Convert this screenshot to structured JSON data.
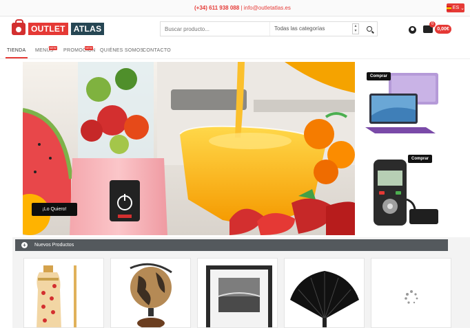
{
  "topbar": {
    "phone": "(+34) 611 938 088",
    "contact": "info@outletatlas.es",
    "language": "ES"
  },
  "brand": {
    "name_part1": "OUTLET",
    "name_part2": "ATLAS",
    "accent": "#e53935",
    "dark": "#264653"
  },
  "search": {
    "placeholder": "Buscar producto...",
    "category": "Todas las categorías"
  },
  "cart": {
    "count": "0",
    "total": "0,00€"
  },
  "nav": {
    "items": [
      {
        "label": "TIENDA"
      },
      {
        "label": "MENÚS",
        "badge": "NEW"
      },
      {
        "label": "PROMOCIÓN",
        "badge": "NEW"
      },
      {
        "label": "QUIÉNES SOMOS"
      },
      {
        "label": "CONTACTO"
      }
    ]
  },
  "hero": {
    "cta": "¡Lo Quiero!"
  },
  "side_banners": [
    {
      "cta": "Comprar"
    },
    {
      "cta": "Comprar"
    }
  ],
  "products": {
    "section_title": "Nuevos Productos",
    "icons": [
      "bottle-icon",
      "globe-icon",
      "frame-icon",
      "fan-icon",
      "loading-spinner-icon"
    ]
  }
}
